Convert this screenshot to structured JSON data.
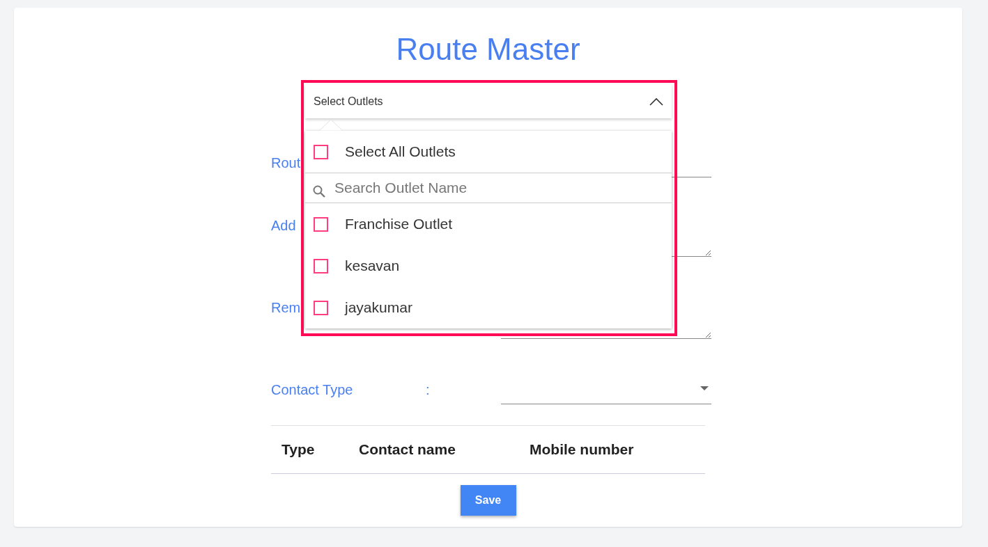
{
  "title": "Route Master",
  "outlet_select": {
    "label": "Select Outlets",
    "expanded": true,
    "select_all": {
      "label": "Select All Outlets",
      "checked": false
    },
    "search": {
      "placeholder": "Search Outlet Name"
    },
    "options": [
      {
        "label": "Franchise Outlet",
        "checked": false
      },
      {
        "label": "kesavan",
        "checked": false
      },
      {
        "label": "jayakumar",
        "checked": false
      }
    ]
  },
  "form_fields": [
    {
      "label": "Rout",
      "kind": "input"
    },
    {
      "label": "Add",
      "kind": "textarea"
    },
    {
      "label": "Rem",
      "kind": "textarea"
    },
    {
      "label": "Contact Type",
      "separator": ":",
      "kind": "select"
    }
  ],
  "table": {
    "columns": [
      "Type",
      "Contact name",
      "Mobile number"
    ]
  },
  "save_button": "Save"
}
